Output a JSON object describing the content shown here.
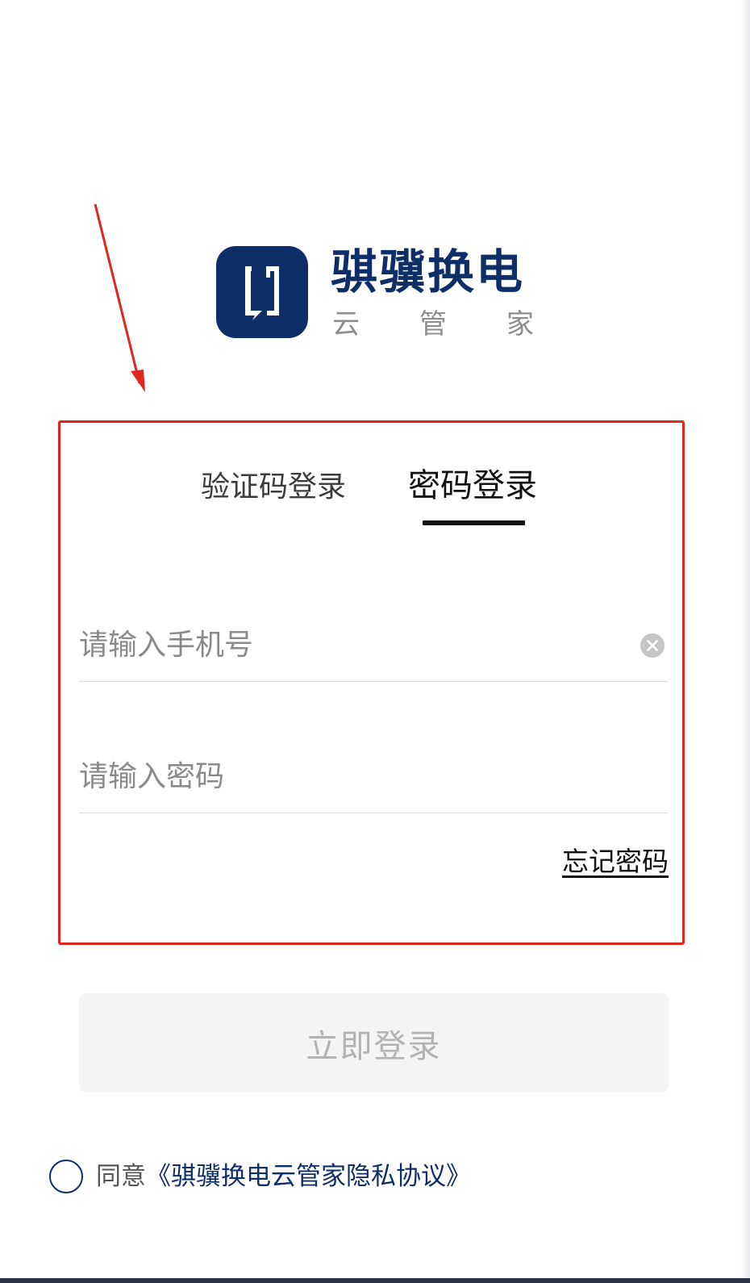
{
  "brand": {
    "name": "骐骥换电",
    "subtitle_chars": [
      "云",
      "管",
      "家"
    ],
    "color": "#0e2e68"
  },
  "tabs": [
    {
      "label": "验证码登录",
      "active": false
    },
    {
      "label": "密码登录",
      "active": true
    }
  ],
  "form": {
    "phone_placeholder": "请输入手机号",
    "phone_value": "",
    "password_placeholder": "请输入密码",
    "password_value": "",
    "forgot_label": "忘记密码"
  },
  "login_button_label": "立即登录",
  "agreement": {
    "checked": false,
    "prefix": "同意",
    "link_label": "《骐骥换电云管家隐私协议》"
  },
  "annotation": {
    "highlight_color": "#e0261e"
  },
  "icons": {
    "clear": "close-circle-icon",
    "logo": "app-logo-icon"
  }
}
